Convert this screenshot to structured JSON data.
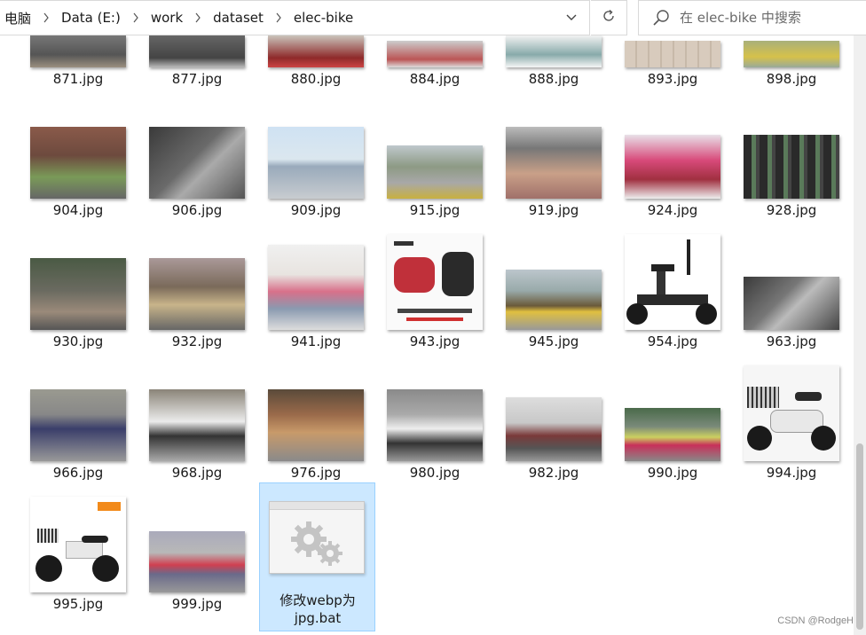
{
  "breadcrumb": {
    "items": [
      "电脑",
      "Data (E:)",
      "work",
      "dataset",
      "elec-bike"
    ]
  },
  "search": {
    "placeholder": "在 elec-bike 中搜索"
  },
  "icons": {
    "chevron": "chevron-right-icon",
    "dropdown": "chevron-down-icon",
    "refresh": "refresh-icon",
    "search": "search-icon",
    "settings": "gears-icon"
  },
  "colors": {
    "selection_bg": "#cce8ff",
    "selection_border": "#99d1ff"
  },
  "files": [
    {
      "name": "871.jpg"
    },
    {
      "name": "877.jpg"
    },
    {
      "name": "880.jpg"
    },
    {
      "name": "884.jpg"
    },
    {
      "name": "888.jpg"
    },
    {
      "name": "893.jpg"
    },
    {
      "name": "898.jpg"
    },
    {
      "name": "904.jpg"
    },
    {
      "name": "906.jpg"
    },
    {
      "name": "909.jpg"
    },
    {
      "name": "915.jpg"
    },
    {
      "name": "919.jpg"
    },
    {
      "name": "924.jpg"
    },
    {
      "name": "928.jpg"
    },
    {
      "name": "930.jpg"
    },
    {
      "name": "932.jpg"
    },
    {
      "name": "941.jpg"
    },
    {
      "name": "943.jpg"
    },
    {
      "name": "945.jpg"
    },
    {
      "name": "954.jpg"
    },
    {
      "name": "963.jpg"
    },
    {
      "name": "966.jpg"
    },
    {
      "name": "968.jpg"
    },
    {
      "name": "976.jpg"
    },
    {
      "name": "980.jpg"
    },
    {
      "name": "982.jpg"
    },
    {
      "name": "990.jpg"
    },
    {
      "name": "994.jpg"
    },
    {
      "name": "995.jpg"
    },
    {
      "name": "999.jpg"
    },
    {
      "name": "修改webp为jpg.bat",
      "line1": "修改webp为",
      "line2": "jpg.bat",
      "selected": true
    }
  ],
  "watermark": "CSDN @RodgeH"
}
